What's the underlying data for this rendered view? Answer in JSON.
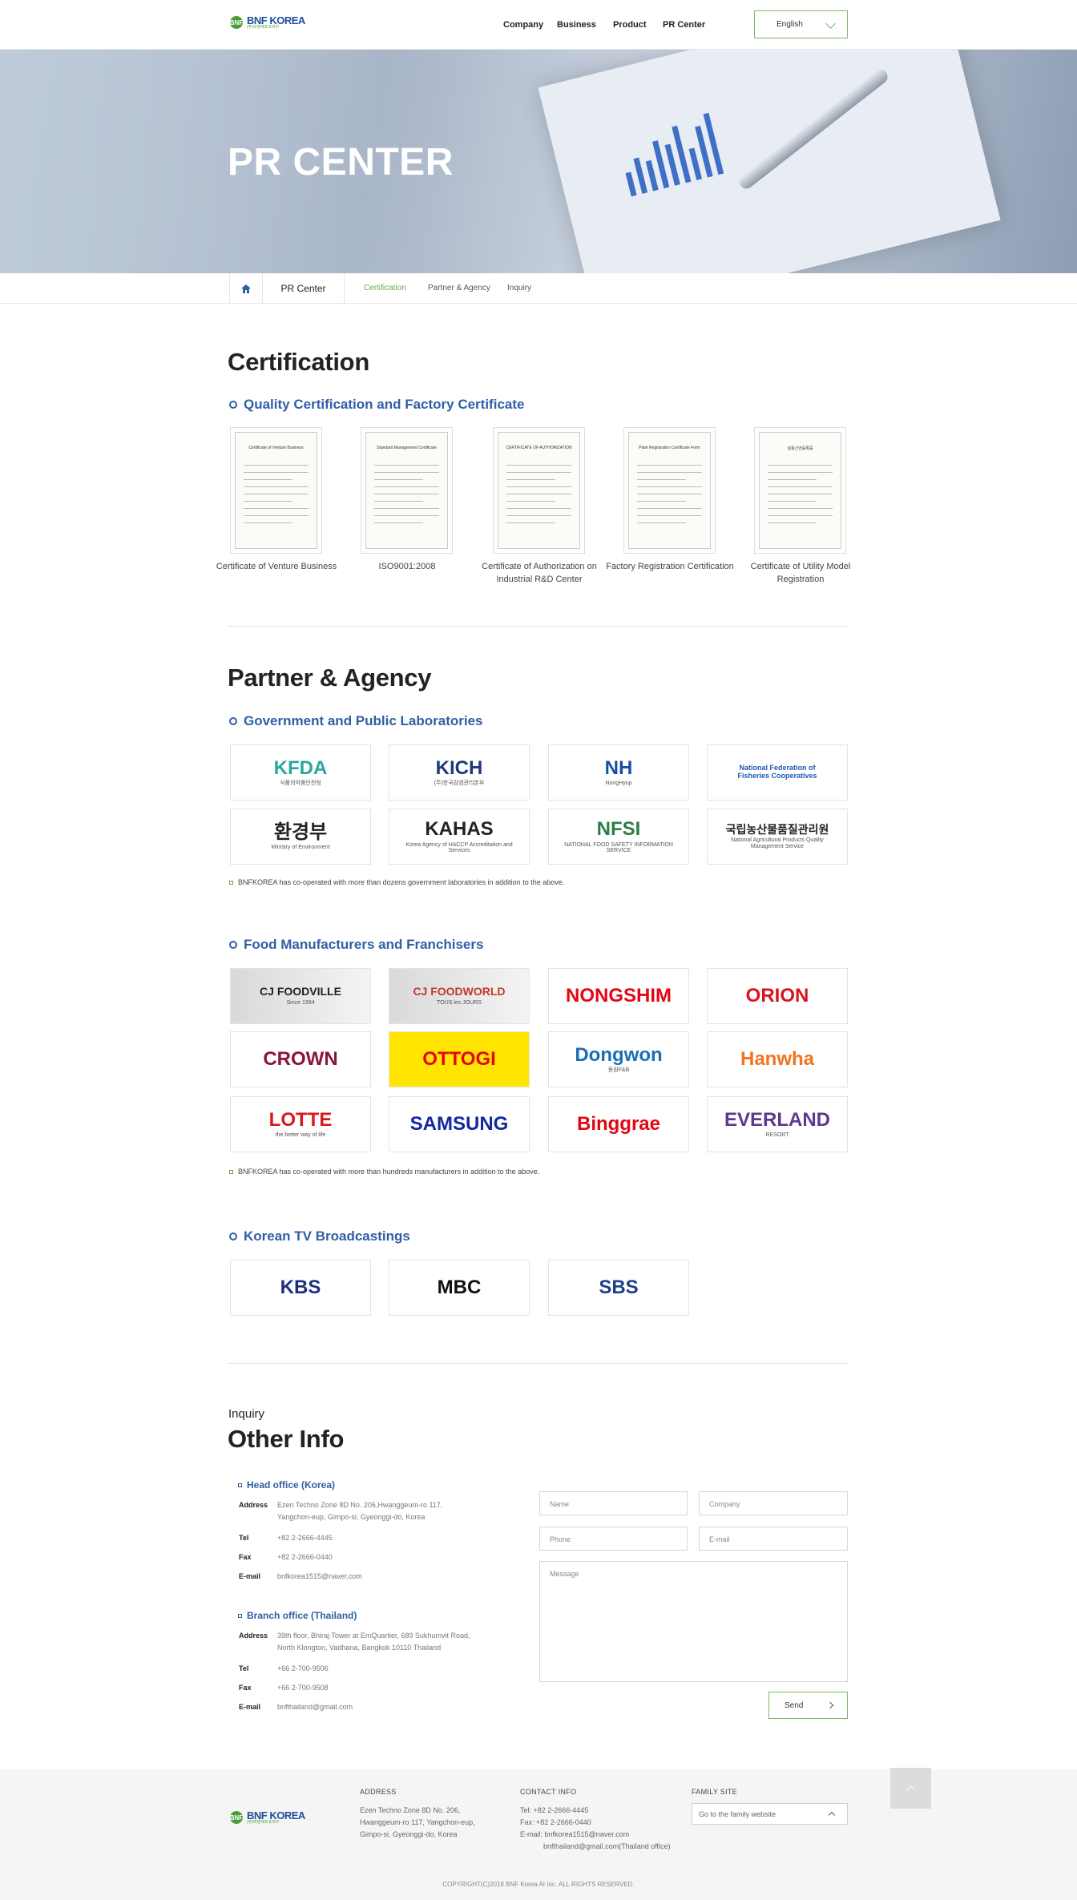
{
  "header": {
    "logo_text": "BNF KOREA",
    "logo_sub": "(주)비엔에프코리아",
    "nav": [
      "Company",
      "Business",
      "Product",
      "PR Center"
    ],
    "language": "English"
  },
  "hero": {
    "title": "PR CENTER"
  },
  "breadcrumb": {
    "current": "PR Center",
    "subs": [
      "Certification",
      "Partner & Agency",
      "Inquiry"
    ]
  },
  "certification": {
    "heading": "Certification",
    "subheading": "Quality Certification and Factory Certificate",
    "items": [
      {
        "caption": "Certificate of Venture Business",
        "doc_title": "Certificate of Venture Business"
      },
      {
        "caption": "ISO9001:2008",
        "doc_title": "Standard Management Certificate"
      },
      {
        "caption": "Certificate of Authorization on Industrial R&D Center",
        "doc_title": "CERTIFICATE OF AUTHORIZATION"
      },
      {
        "caption": "Factory Registration Certification",
        "doc_title": "Plant Registration Certificate Form"
      },
      {
        "caption": "Certificate of Utility Model Registration",
        "doc_title": "실용신안등록증"
      }
    ]
  },
  "partner": {
    "heading": "Partner & Agency",
    "gov": {
      "subheading": "Government and Public Laboratories",
      "logos": [
        {
          "main": "KFDA",
          "sub": "식품의약품안전청",
          "color": "#2aa7a0"
        },
        {
          "main": "KICH",
          "sub": "(주)한국감염관리본부",
          "color": "#1b3a7a"
        },
        {
          "main": "NH",
          "sub": "NongHyup",
          "color": "#1b4ea3"
        },
        {
          "main": "National Federation of Fisheries Cooperatives",
          "sub": "",
          "color": "#1e5bb0"
        },
        {
          "main": "환경부",
          "sub": "Ministry of Environment",
          "color": "#222"
        },
        {
          "main": "KAHAS",
          "sub": "Korea Agency of HACCP Accreditation and Services",
          "color": "#222"
        },
        {
          "main": "NFSI",
          "sub": "NATIONAL FOOD SAFETY INFORMATION SERVICE",
          "color": "#2d7d46"
        },
        {
          "main": "국립농산물품질관리원",
          "sub": "National Agricultural Products Quality Management Service",
          "color": "#222"
        }
      ],
      "note": "BNFKOREA has co-operated with more than dozens government laboratories in addition to the above."
    },
    "food": {
      "subheading": "Food Manufacturers and Franchisers",
      "logos": [
        {
          "main": "CJ FOODVILLE",
          "sub": "Since 1994",
          "color": "#222"
        },
        {
          "main": "CJ FOODWORLD",
          "sub": "TOUS les JOURS",
          "color": "#c0392b"
        },
        {
          "main": "NONGSHIM",
          "sub": "",
          "color": "#e30613"
        },
        {
          "main": "ORION",
          "sub": "",
          "color": "#d7141d"
        },
        {
          "main": "CROWN",
          "sub": "",
          "color": "#8a1538"
        },
        {
          "main": "OTTOGI",
          "sub": "",
          "color": "#e30613"
        },
        {
          "main": "Dongwon",
          "sub": "동원F&B",
          "color": "#1a6fb5"
        },
        {
          "main": "Hanwha",
          "sub": "",
          "color": "#f37321"
        },
        {
          "main": "LOTTE",
          "sub": "the better way of life",
          "color": "#d71920"
        },
        {
          "main": "SAMSUNG",
          "sub": "",
          "color": "#1428a0"
        },
        {
          "main": "Binggrae",
          "sub": "",
          "color": "#e30613"
        },
        {
          "main": "EVERLAND",
          "sub": "RESORT",
          "color": "#5b3a8e"
        }
      ],
      "note": "BNFKOREA has co-operated with more than hundreds manufacturers in addition to the above."
    },
    "tv": {
      "subheading": "Korean TV Broadcastings",
      "logos": [
        {
          "main": "KBS",
          "color": "#1e2f7d"
        },
        {
          "main": "MBC",
          "color": "#111"
        },
        {
          "main": "SBS",
          "color": "#1e3f8a"
        }
      ]
    }
  },
  "inquiry": {
    "kicker": "Inquiry",
    "heading": "Other Info",
    "head_office": {
      "title": "Head office (Korea)",
      "address_label": "Address",
      "address": [
        "Ezen Techno Zone 8D No. 206,Hwanggeum-ro 117,",
        "Yangchon-eup, Gimpo-si, Gyeonggi-do, Korea"
      ],
      "tel_label": "Tel",
      "tel": "+82 2-2666-4445",
      "fax_label": "Fax",
      "fax": "+82 2-2666-0440",
      "email_label": "E-mail",
      "email": "bnfkorea1515@naver.com"
    },
    "branch_office": {
      "title": "Branch office (Thailand)",
      "address_label": "Address",
      "address": [
        "39th floor, Bhiraj Tower at EmQuartier, 689 Sukhumvit Road,",
        "North Klongton, Vadhana, Bangkok 10110 Thailand"
      ],
      "tel_label": "Tel",
      "tel": "+66 2-700-9506",
      "fax_label": "Fax",
      "fax": "+66 2-700-9508",
      "email_label": "E-mail",
      "email": "bnfthailand@gmail.com"
    },
    "form": {
      "name_placeholder": "Name",
      "company_placeholder": "Company",
      "phone_placeholder": "Phone",
      "email_placeholder": "E-mail",
      "message_placeholder": "Message",
      "send_label": "Send"
    }
  },
  "footer": {
    "address_title": "ADDRESS",
    "address": [
      "Ezen Techno Zone 8D No. 206,",
      "Hwanggeum-ro 117, Yangchon-eup,",
      "Gimpo-si, Gyeonggi-do, Korea"
    ],
    "contact_title": "CONTACT INFO",
    "contact": [
      "Tel: +82 2-2666-4445",
      "Fax: +82 2-2666-0440",
      "E-mail: bnfkorea1515@naver.com",
      "bnfthailand@gmail.com(Thailand office)"
    ],
    "family_title": "FAMILY SITE",
    "family_placeholder": "Go to the family website",
    "copyright": "COPYRIGHT(C)2018 BNF Korea AI Inc. ALL RIGHTS RESERVED."
  },
  "colors": {
    "accent_green": "#6aa84f",
    "accent_blue": "#2f5fa5"
  }
}
